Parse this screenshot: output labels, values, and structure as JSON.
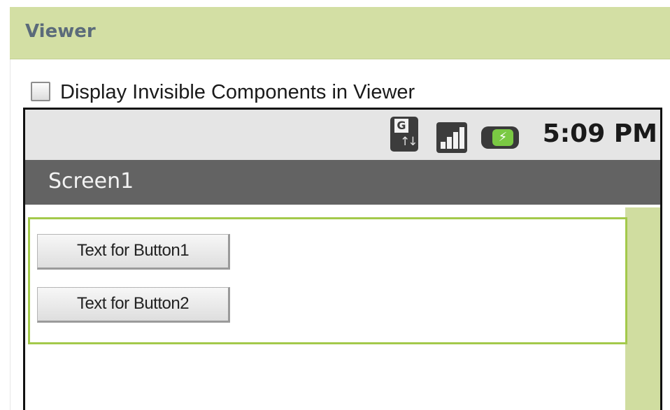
{
  "panel": {
    "title": "Viewer"
  },
  "options": {
    "display_invisible_label": "Display Invisible Components in Viewer",
    "display_invisible_checked": false
  },
  "status_bar": {
    "gprs_letter": "G",
    "gprs_arrows": "↑↓",
    "battery_glyph": "⚡",
    "time": "5:09 PM",
    "icons": [
      "gprs-data-icon",
      "signal-strength-icon",
      "battery-charging-icon"
    ]
  },
  "screen": {
    "title": "Screen1"
  },
  "components": {
    "button1_text": "Text for Button1",
    "button2_text": "Text for Button2"
  },
  "colors": {
    "header_bg": "#d3dfa4",
    "title_bar_bg": "#636363",
    "arrangement_border": "#a3c94b",
    "battery_green": "#7ac943"
  }
}
